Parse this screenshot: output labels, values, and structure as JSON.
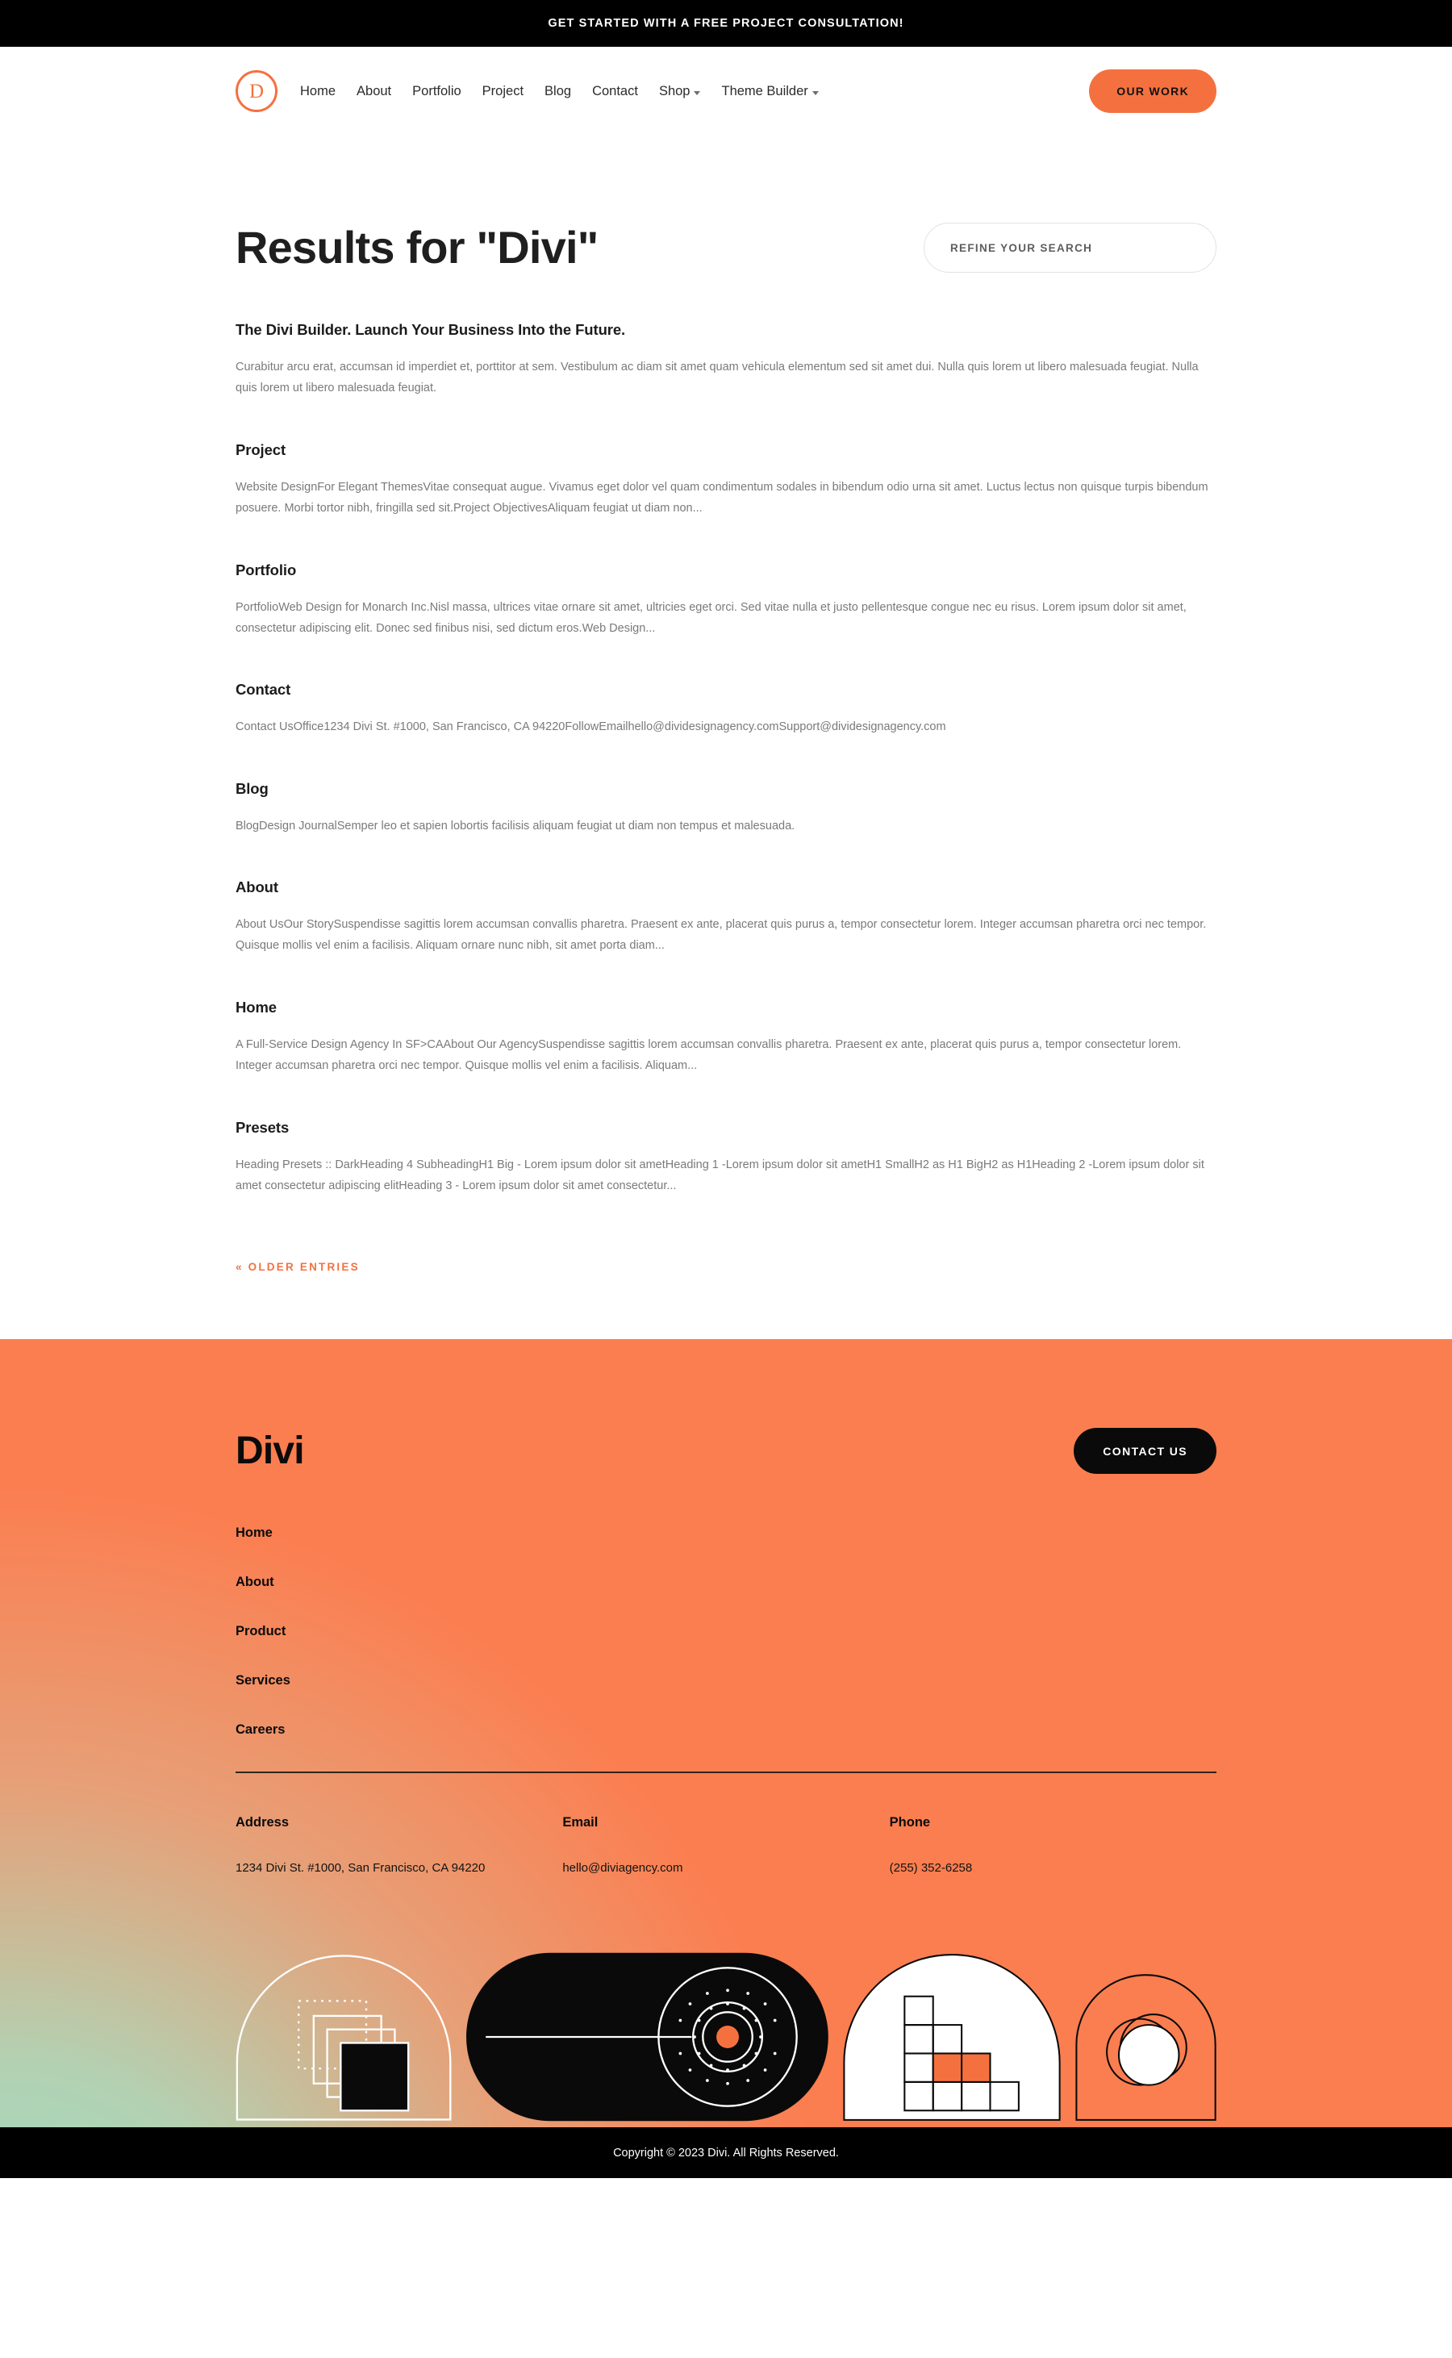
{
  "announcement": {
    "text": "GET STARTED WITH A FREE PROJECT CONSULTATION!"
  },
  "header": {
    "logo_letter": "D",
    "nav": [
      {
        "label": "Home",
        "has_dropdown": false
      },
      {
        "label": "About",
        "has_dropdown": false
      },
      {
        "label": "Portfolio",
        "has_dropdown": false
      },
      {
        "label": "Project",
        "has_dropdown": false
      },
      {
        "label": "Blog",
        "has_dropdown": false
      },
      {
        "label": "Contact",
        "has_dropdown": false
      },
      {
        "label": "Shop",
        "has_dropdown": true
      },
      {
        "label": "Theme Builder",
        "has_dropdown": true
      }
    ],
    "cta_label": "OUR WORK"
  },
  "search": {
    "page_title": "Results for \"Divi\"",
    "refine_label": "REFINE YOUR SEARCH"
  },
  "results": [
    {
      "title": "The Divi Builder. Launch Your Business Into the Future.",
      "excerpt": "Curabitur arcu erat, accumsan id imperdiet et, porttitor at sem. Vestibulum ac diam sit amet quam vehicula elementum sed sit amet dui. Nulla quis lorem ut libero malesuada feugiat. Nulla quis lorem ut libero malesuada feugiat."
    },
    {
      "title": "Project",
      "excerpt": "Website DesignFor Elegant ThemesVitae consequat augue. Vivamus eget dolor vel quam condimentum sodales in bibendum odio urna sit amet. Luctus lectus non quisque turpis bibendum posuere. Morbi tortor nibh, fringilla sed sit.Project ObjectivesAliquam feugiat ut diam non..."
    },
    {
      "title": "Portfolio",
      "excerpt": "PortfolioWeb Design for Monarch Inc.Nisl massa, ultrices vitae ornare sit amet, ultricies eget orci. Sed vitae nulla et justo pellentesque congue nec eu risus. Lorem ipsum dolor sit amet, consectetur adipiscing elit. Donec sed finibus nisi, sed dictum eros.Web Design..."
    },
    {
      "title": "Contact",
      "excerpt": "Contact UsOffice1234 Divi St. #1000, San Francisco, CA 94220FollowEmailhello@dividesignagency.comSupport@dividesignagency.com"
    },
    {
      "title": "Blog",
      "excerpt": "BlogDesign JournalSemper leo et sapien lobortis facilisis aliquam feugiat ut diam non tempus et malesuada."
    },
    {
      "title": "About",
      "excerpt": "About UsOur StorySuspendisse sagittis lorem accumsan convallis pharetra. Praesent ex ante, placerat quis purus a, tempor consectetur lorem. Integer accumsan pharetra orci nec tempor. Quisque mollis vel enim a facilisis. Aliquam ornare nunc nibh, sit amet porta diam..."
    },
    {
      "title": "Home",
      "excerpt": "A Full-Service Design Agency In SF>CAAbout Our AgencySuspendisse sagittis lorem accumsan convallis pharetra. Praesent ex ante, placerat quis purus a, tempor consectetur lorem. Integer accumsan pharetra orci nec tempor. Quisque mollis vel enim a facilisis. Aliquam..."
    },
    {
      "title": "Presets",
      "excerpt": "Heading Presets :: DarkHeading 4 SubheadingH1 Big - Lorem ipsum dolor sit ametHeading 1 -Lorem ipsum dolor sit ametH1 SmallH2 as H1 BigH2 as H1Heading 2 -Lorem ipsum dolor sit amet consectetur adipiscing elitHeading 3 - Lorem ipsum dolor sit amet consectetur..."
    }
  ],
  "pagination": {
    "older_entries_label": "« OLDER ENTRIES"
  },
  "footer": {
    "logo": "Divi",
    "cta_label": "CONTACT US",
    "links": [
      {
        "label": "Home"
      },
      {
        "label": "About"
      },
      {
        "label": "Product"
      },
      {
        "label": "Services"
      },
      {
        "label": "Careers"
      }
    ],
    "columns": [
      {
        "heading": "Address",
        "value": "1234 Divi St. #1000, San Francisco, CA 94220"
      },
      {
        "heading": "Email",
        "value": "hello@diviagency.com"
      },
      {
        "heading": "Phone",
        "value": "(255) 352-6258"
      }
    ]
  },
  "copyright": {
    "text": "Copyright © 2023 Divi. All Rights Reserved."
  },
  "colors": {
    "brand_orange": "#F4713F",
    "footer_orange": "#FB7E50",
    "footer_gradient_teal": "#96E2CD",
    "black": "#000000",
    "body_text": "#7A7A7A",
    "heading_text": "#1C1C1C"
  }
}
